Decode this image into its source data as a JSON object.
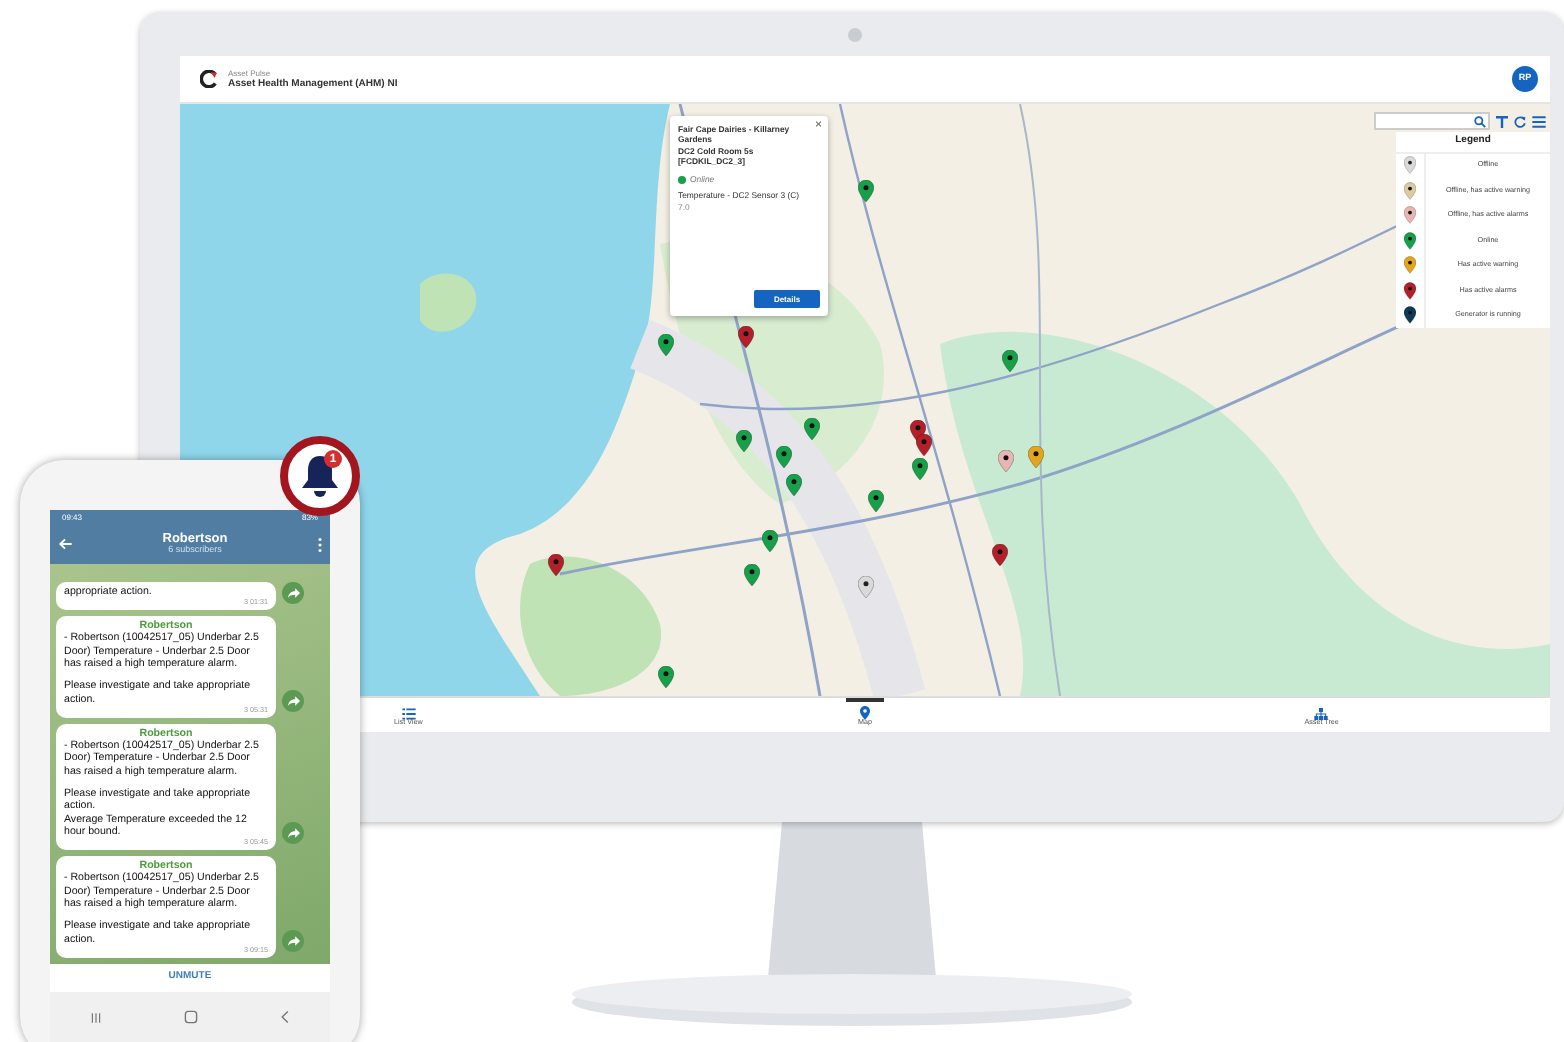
{
  "app": {
    "brand": "Asset Pulse",
    "title": "Asset Health Management (AHM) NI",
    "user_initials": "RP"
  },
  "map": {
    "kind": "picture",
    "markers": [
      {
        "color": "#16a04a"
      },
      {
        "color": "#16a04a"
      },
      {
        "color": "#b3202a"
      },
      {
        "color": "#16a04a"
      },
      {
        "color": "#16a04a"
      },
      {
        "color": "#16a04a"
      },
      {
        "color": "#16a04a"
      },
      {
        "color": "#16a04a"
      },
      {
        "color": "#b3202a"
      },
      {
        "color": "#b3202a"
      },
      {
        "color": "#16a04a"
      },
      {
        "color": "#16a04a"
      },
      {
        "color": "#e3a51c"
      },
      {
        "color": "#e8b4b4"
      },
      {
        "color": "#16a04a"
      },
      {
        "color": "#16a04a"
      },
      {
        "color": "#b3202a"
      },
      {
        "color": "#d9d9d9"
      },
      {
        "color": "#b3202a"
      },
      {
        "color": "#16a04a"
      }
    ],
    "popup": {
      "title": "Fair Cape Dairies - Killarney Gardens",
      "asset": "DC2 Cold Room 5s",
      "code": "[FCDKIL_DC2_3]",
      "status": {
        "label": "Online",
        "color": "#16a04a"
      },
      "sensor": "Temperature - DC2 Sensor 3 (C)",
      "reading": "7.0",
      "close": "×",
      "button": "Details"
    },
    "legend": {
      "title": "Legend",
      "items": [
        {
          "label": "Offline",
          "color": "#d9d9d9"
        },
        {
          "label": "Offline, has active warning",
          "color": "#dccb9c"
        },
        {
          "label": "Offline, has active alarms",
          "color": "#e8b4b4"
        },
        {
          "label": "Online",
          "color": "#16a04a"
        },
        {
          "label": "Has active warning",
          "color": "#e3a51c"
        },
        {
          "label": "Has active alarms",
          "color": "#b3202a"
        },
        {
          "label": "Generator is running",
          "color": "#0d3b57"
        }
      ]
    }
  },
  "bottom_tabs": [
    {
      "label": "List View",
      "kind": "list",
      "selected": false
    },
    {
      "label": "Map",
      "kind": "pin",
      "selected": true
    },
    {
      "label": "Asset Tree",
      "kind": "tree",
      "selected": false
    }
  ],
  "phone": {
    "time": "09:43",
    "battery": "83%",
    "channel": "Robertson",
    "subscribers": "6 subscribers",
    "unmute": "UNMUTE",
    "messages": [
      {
        "paragraphs": [
          [
            "appropriate action."
          ]
        ],
        "views": "3",
        "time": "01:31"
      },
      {
        "sender": "Robertson",
        "paragraphs": [
          [
            "- Robertson (10042517_05) Underbar 2.5 Door) Temperature - Underbar 2.5 Door has raised a high temperature alarm."
          ],
          [
            "Please investigate and take appropriate action."
          ]
        ],
        "views": "3",
        "time": "05:31"
      },
      {
        "sender": "Robertson",
        "paragraphs": [
          [
            "- Robertson (10042517_05) Underbar 2.5 Door) Temperature - Underbar 2.5 Door has raised a high temperature alarm."
          ],
          [
            "Please investigate and take appropriate action.",
            "Average Temperature exceeded the 12 hour bound."
          ]
        ],
        "views": "3",
        "time": "05:45"
      },
      {
        "sender": "Robertson",
        "paragraphs": [
          [
            "- Robertson (10042517_05) Underbar 2.5 Door) Temperature - Underbar 2.5 Door has raised a high temperature alarm."
          ],
          [
            "Please investigate and take appropriate action."
          ]
        ],
        "views": "3",
        "time": "09:15"
      }
    ]
  },
  "alert_badge": {
    "count": "1"
  }
}
